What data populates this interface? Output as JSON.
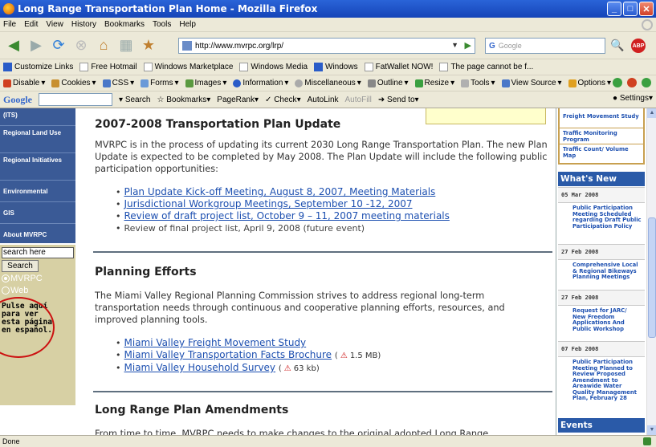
{
  "window": {
    "title": "Long Range Transportation Plan Home - Mozilla Firefox"
  },
  "menu": [
    "File",
    "Edit",
    "View",
    "History",
    "Bookmarks",
    "Tools",
    "Help"
  ],
  "nav": {
    "url": "http://www.mvrpc.org/lrp/",
    "search_placeholder": "Google",
    "search_engine_label": "G"
  },
  "bookmarks": [
    "Customize Links",
    "Free Hotmail",
    "Windows Marketplace",
    "Windows Media",
    "Windows",
    "FatWallet NOW!",
    "The page cannot be f..."
  ],
  "webdev": [
    "Disable",
    "Cookies",
    "CSS",
    "Forms",
    "Images",
    "Information",
    "Miscellaneous",
    "Outline",
    "Resize",
    "Tools",
    "View Source",
    "Options"
  ],
  "google_toolbar": {
    "logo": "Google",
    "items": [
      "Search",
      "Bookmarks",
      "PageRank",
      "Check",
      "AutoLink",
      "AutoFill",
      "Send to"
    ],
    "settings": "Settings"
  },
  "leftnav": {
    "items": [
      "(ITS)",
      "Regional Land Use",
      "Regional Initiatives",
      "Environmental",
      "GIS",
      "About MVRPC"
    ],
    "search_value": "search here",
    "search_button": "Search",
    "radio_mvrpc": "MVRPC",
    "radio_web": "Web",
    "spanish_text": "Pulse aquí para ver esta página en español."
  },
  "main": {
    "section1": {
      "heading": "2007-2008 Transportation Plan Update",
      "body": "MVRPC is in the process of updating its current 2030 Long Range Transportation Plan. The new Plan Update is expected to be completed by May 2008. The Plan Update will include the following public participation opportunities:",
      "items": [
        {
          "text": "Plan Update Kick-off Meeting, August 8, 2007, Meeting Materials"
        },
        {
          "text": "Jurisdictional Workgroup Meetings, September 10 -12, 2007"
        },
        {
          "text": "Review of draft project list, October 9 – 11, 2007 meeting materials"
        }
      ],
      "future": "Review of final project list, April 9, 2008 (future event)"
    },
    "section2": {
      "heading": "Planning Efforts",
      "body": "The Miami Valley Regional Planning Commission strives to address regional long-term transportation needs through continuous and cooperative planning efforts, resources, and improved planning tools.",
      "items": [
        {
          "text": "Miami Valley Freight Movement Study"
        },
        {
          "text": "Miami Valley Transportation Facts Brochure",
          "size": "1.5 MB)",
          "open": "("
        },
        {
          "text": "Miami Valley Household Survey",
          "size": "63 kb)",
          "open": "("
        }
      ]
    },
    "section3": {
      "heading": "Long Range Plan Amendments",
      "body": "From time to time, MVRPC needs to make changes to the original adopted Long Range"
    }
  },
  "right": {
    "toplinks": [
      "Freight Movement Study",
      "Traffic Monitoring Program",
      "Traffic Count/ Volume Map"
    ],
    "whats_new": "What's New",
    "news": [
      {
        "date": "05 Mar 2008",
        "text": "Public Participation Meeting Scheduled regarding Draft Public Participation Policy"
      },
      {
        "date": "27 Feb 2008",
        "text": "Comprehensive Local & Regional Bikeways Planning Meetings"
      },
      {
        "date": "27 Feb 2008",
        "text": "Request for JARC/ New Freedom Applications And Public Workshop"
      },
      {
        "date": "07 Feb 2008",
        "text": "Public Participation Meeting Planned to Review Proposed Amendment to Areawide Water Quality Management Plan, February 28"
      }
    ],
    "events": "Events"
  },
  "status": {
    "text": "Done"
  }
}
